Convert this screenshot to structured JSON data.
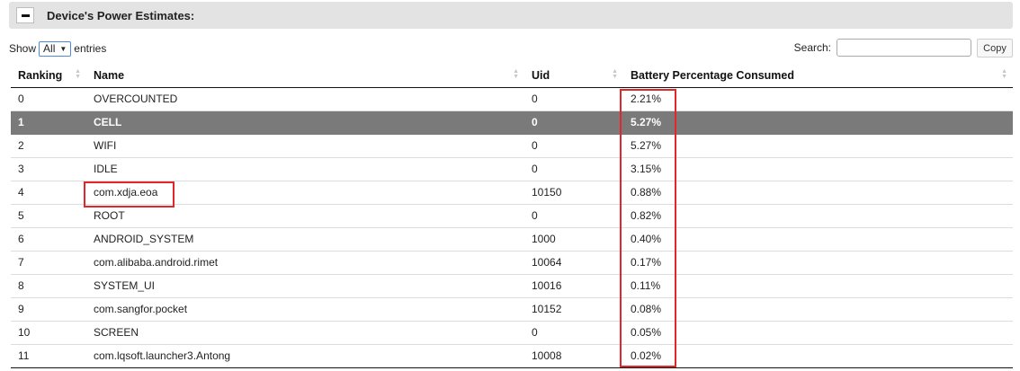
{
  "header": {
    "title": "Device's Power Estimates:"
  },
  "controls": {
    "show_label": "Show",
    "entries_selected": "All",
    "entries_label": "entries",
    "search_label": "Search:",
    "search_value": "",
    "copy_label": "Copy"
  },
  "table": {
    "columns": [
      "Ranking",
      "Name",
      "Uid",
      "Battery Percentage Consumed"
    ],
    "selected_row": 1,
    "rows": [
      [
        "0",
        "OVERCOUNTED",
        "0",
        "2.21%"
      ],
      [
        "1",
        "CELL",
        "0",
        "5.27%"
      ],
      [
        "2",
        "WIFI",
        "0",
        "5.27%"
      ],
      [
        "3",
        "IDLE",
        "0",
        "3.15%"
      ],
      [
        "4",
        "com.xdja.eoa",
        "10150",
        "0.88%"
      ],
      [
        "5",
        "ROOT",
        "0",
        "0.82%"
      ],
      [
        "6",
        "ANDROID_SYSTEM",
        "1000",
        "0.40%"
      ],
      [
        "7",
        "com.alibaba.android.rimet",
        "10064",
        "0.17%"
      ],
      [
        "8",
        "SYSTEM_UI",
        "10016",
        "0.11%"
      ],
      [
        "9",
        "com.sangfor.pocket",
        "10152",
        "0.08%"
      ],
      [
        "10",
        "SCREEN",
        "0",
        "0.05%"
      ],
      [
        "11",
        "com.lqsoft.launcher3.Antong",
        "10008",
        "0.02%"
      ]
    ]
  },
  "colors": {
    "highlight": "#e2272b",
    "selected_row_bg": "#7a7a7a",
    "header_bg": "#e3e3e3"
  }
}
